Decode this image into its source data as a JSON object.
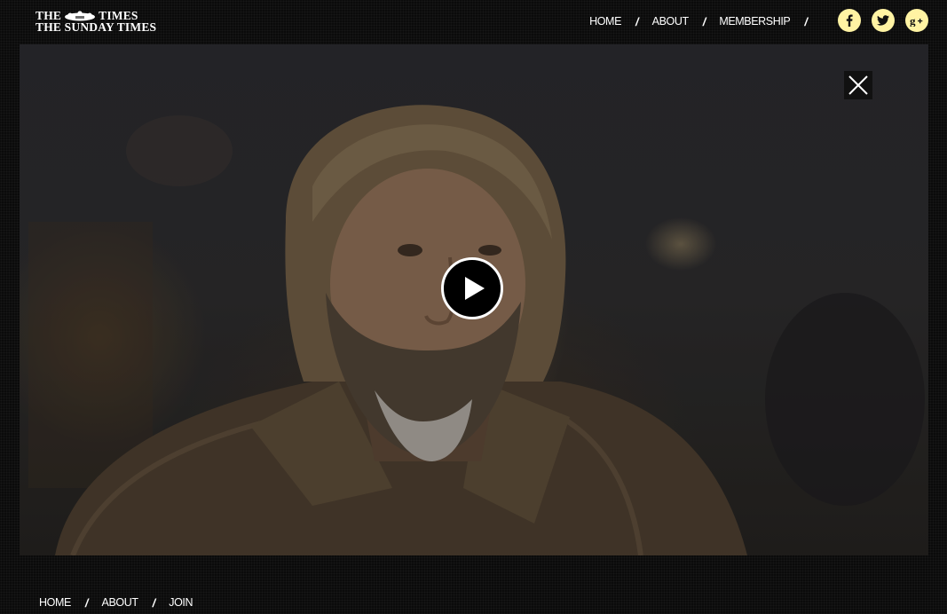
{
  "logo": {
    "line1_left": "THE",
    "line1_right": "TIMES",
    "line2": "THE SUNDAY TIMES"
  },
  "top_nav": {
    "items": [
      "HOME",
      "ABOUT",
      "MEMBERSHIP"
    ],
    "separator": "/"
  },
  "social": {
    "icons": [
      "facebook-icon",
      "twitter-icon",
      "google-plus-icon"
    ],
    "background": "#fff3a3"
  },
  "video": {
    "close_icon": "close-icon",
    "play_icon": "play-icon"
  },
  "bottom_nav": {
    "items": [
      "HOME",
      "ABOUT",
      "JOIN"
    ],
    "separator": "/"
  },
  "colors": {
    "background": "#0b0b0b",
    "text": "#ffffff",
    "accent": "#fff3a3"
  }
}
